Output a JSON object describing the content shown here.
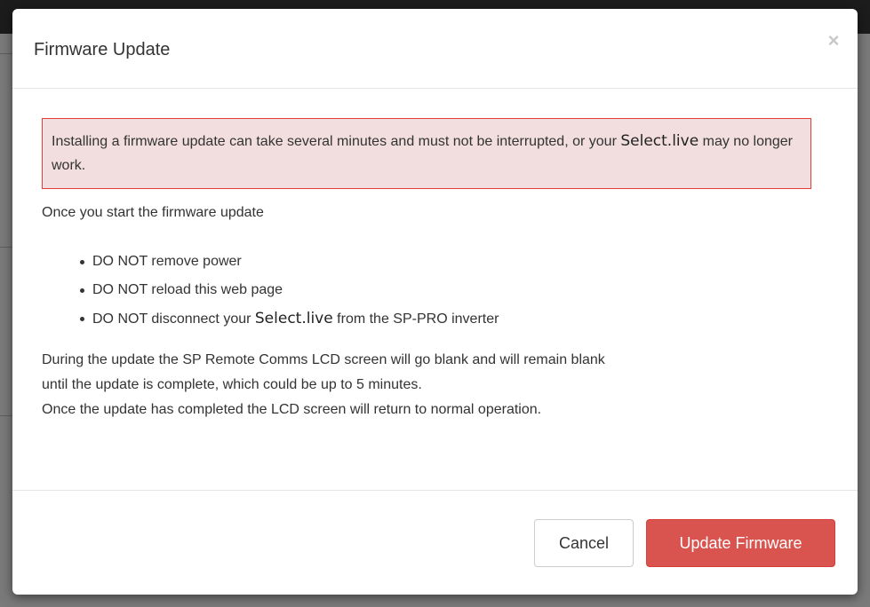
{
  "modal": {
    "title": "Firmware Update",
    "close_label": "×",
    "alert": {
      "text_before": "Installing a firmware update can take several minutes and must not be interrupted, or your ",
      "brand": "Select.live",
      "text_after": " may no longer work."
    },
    "intro": "Once you start the firmware update",
    "warnings": [
      {
        "text": "DO NOT remove power"
      },
      {
        "text": "DO NOT reload this web page"
      },
      {
        "text_before": "DO NOT disconnect your ",
        "brand": "Select.live",
        "text_after": " from the SP-PRO inverter"
      }
    ],
    "info_lines": [
      "During the update the SP Remote Comms LCD screen will go blank and will remain blank",
      "until the update is complete, which could be up to 5 minutes.",
      "Once the update has completed the LCD screen will return to normal operation."
    ],
    "buttons": {
      "cancel": "Cancel",
      "update": "Update Firmware"
    }
  },
  "colors": {
    "alert_background": "#f2dede",
    "alert_border": "#e23c3c",
    "danger_button": "#d9534f",
    "overlay": "#6f6f6f"
  }
}
